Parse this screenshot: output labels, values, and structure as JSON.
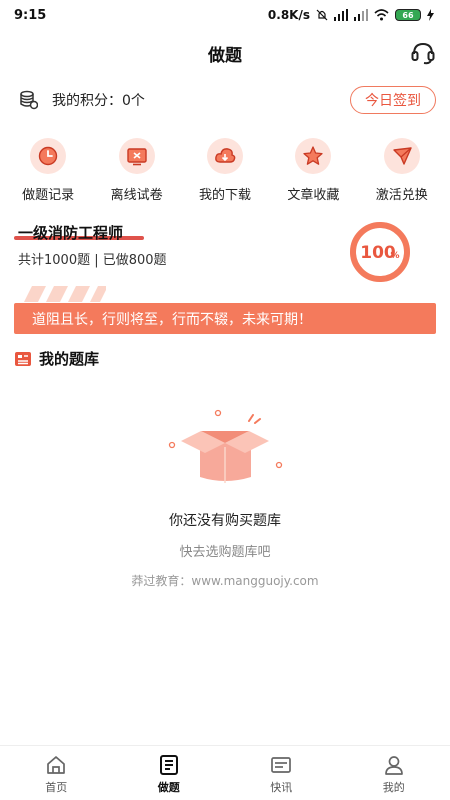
{
  "status": {
    "time": "9:15",
    "speed": "0.8K/s",
    "battery": "66"
  },
  "header": {
    "title": "做题"
  },
  "points": {
    "label": "我的积分：0个",
    "signin_label": "今日签到"
  },
  "quick_actions": [
    {
      "label": "做题记录",
      "icon": "clock-icon"
    },
    {
      "label": "离线试卷",
      "icon": "offline-paper-icon"
    },
    {
      "label": "我的下载",
      "icon": "cloud-download-icon"
    },
    {
      "label": "文章收藏",
      "icon": "star-icon"
    },
    {
      "label": "激活兑换",
      "icon": "send-icon"
    }
  ],
  "exam": {
    "title": "一级消防工程师",
    "stats": "共计1000题 | 已做800题",
    "progress_value": "100",
    "progress_unit": "%"
  },
  "motto": "道阻且长，行则将至，行而不辍，未来可期！",
  "bank": {
    "title": "我的题库"
  },
  "empty_state": {
    "title": "你还没有购买题库",
    "subtitle": "快去选购题库吧",
    "footer": "莽过教育：www.mangguojy.com"
  },
  "tabs": [
    {
      "label": "首页",
      "icon": "home-icon",
      "active": false
    },
    {
      "label": "做题",
      "icon": "practice-icon",
      "active": true
    },
    {
      "label": "快讯",
      "icon": "news-icon",
      "active": false
    },
    {
      "label": "我的",
      "icon": "profile-icon",
      "active": false
    }
  ],
  "colors": {
    "accent": "#f47a5c",
    "accent_dark": "#e9573f",
    "icon_bg": "#fde3dc"
  }
}
